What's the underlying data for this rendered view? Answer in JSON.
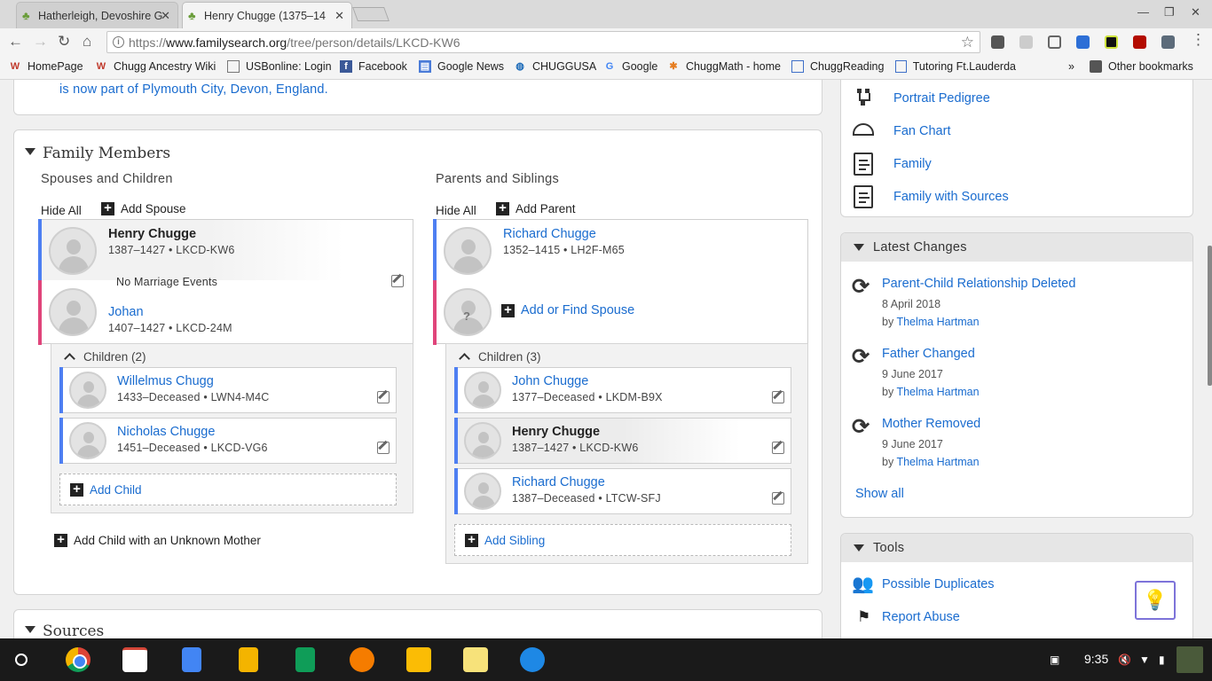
{
  "browser": {
    "tabs": [
      {
        "title": "Hatherleigh, Devoshire G"
      },
      {
        "title": "Henry Chugge (1375–14"
      }
    ],
    "url_prefix": "https://",
    "url_domain": "www.familysearch.org",
    "url_path": "/tree/person/details/LKCD-KW6",
    "bookmarks": [
      "HomePage",
      "Chugg Ancestry Wiki",
      "USBonline: Login",
      "Facebook",
      "Google News",
      "CHUGGUSA",
      "Google",
      "ChuggMath - home",
      "ChuggReading",
      "Tutoring Ft.Lauderda"
    ],
    "bookmarks_overflow": "»",
    "other_bookmarks": "Other bookmarks"
  },
  "top_note": "is now part of Plymouth City, Devon, England.",
  "family": {
    "title": "Family Members",
    "spouses_heading": "Spouses and Children",
    "parents_heading": "Parents and Siblings",
    "hide_all": "Hide All",
    "add_spouse": "Add Spouse",
    "add_parent": "Add Parent",
    "couple": {
      "husband": {
        "name": "Henry Chugge",
        "info": "1387–1427 • LKCD-KW6"
      },
      "marriage": "No Marriage Events",
      "wife": {
        "name": "Johan",
        "info": "1407–1427 • LKCD-24M"
      }
    },
    "children_label": "Children (2)",
    "children": [
      {
        "name": "Willelmus Chugg",
        "info": "1433–Deceased • LWN4-M4C"
      },
      {
        "name": "Nicholas Chugge",
        "info": "1451–Deceased • LKCD-VG6"
      }
    ],
    "add_child": "Add Child",
    "add_child_unknown": "Add Child with an Unknown Mother",
    "parents": {
      "father": {
        "name": "Richard Chugge",
        "info": "1352–1415 • LH2F-M65"
      },
      "add_spouse": "Add or Find Spouse"
    },
    "siblings_label": "Children (3)",
    "siblings": [
      {
        "name": "John Chugge",
        "info": "1377–Deceased • LKDM-B9X"
      },
      {
        "name": "Henry Chugge",
        "info": "1387–1427 • LKCD-KW6"
      },
      {
        "name": "Richard Chugge",
        "info": "1387–Deceased • LTCW-SFJ"
      }
    ],
    "add_sibling": "Add Sibling"
  },
  "sources_title": "Sources",
  "views": [
    "Portrait Pedigree",
    "Fan Chart",
    "Family",
    "Family with Sources"
  ],
  "latest_changes": {
    "title": "Latest Changes",
    "items": [
      {
        "title": "Parent-Child Relationship Deleted",
        "date": "8 April 2018",
        "by": "by",
        "user": "Thelma Hartman"
      },
      {
        "title": "Father Changed",
        "date": "9 June 2017",
        "by": "by",
        "user": "Thelma Hartman"
      },
      {
        "title": "Mother Removed",
        "date": "9 June 2017",
        "by": "by",
        "user": "Thelma Hartman"
      }
    ],
    "show_all": "Show all"
  },
  "tools": {
    "title": "Tools",
    "items": [
      "Possible Duplicates",
      "Report Abuse"
    ]
  },
  "shelf": {
    "clock": "9:35"
  },
  "colors": {
    "link": "#1a6ccf",
    "male": "#4e7ff2",
    "female": "#e0457b",
    "accent": "#7d73d9"
  }
}
